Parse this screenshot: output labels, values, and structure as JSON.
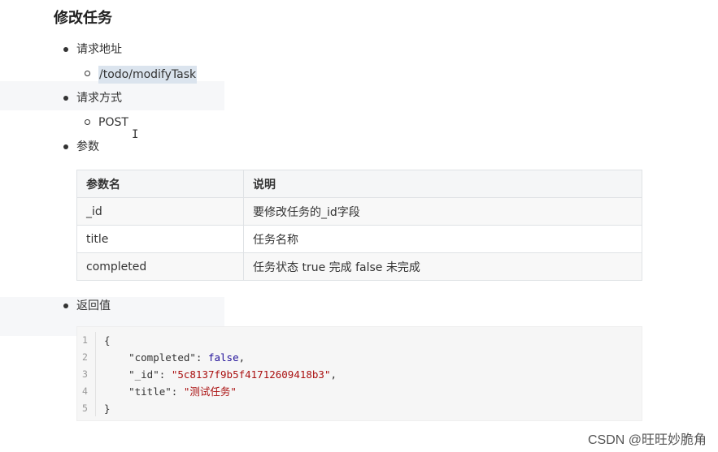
{
  "heading": "修改任务",
  "sections": {
    "request_url_label": "请求地址",
    "request_url_value": "/todo/modifyTask",
    "request_method_label": "请求方式",
    "request_method_value": "POST",
    "params_label": "参数",
    "return_label": "返回值"
  },
  "params_table": {
    "headers": [
      "参数名",
      "说明"
    ],
    "rows": [
      [
        "_id",
        "要修改任务的_id字段"
      ],
      [
        "title",
        "任务名称"
      ],
      [
        "completed",
        "任务状态 true 完成 false 未完成"
      ]
    ]
  },
  "code_block": {
    "line_numbers": [
      "1",
      "2",
      "3",
      "4",
      "5"
    ],
    "lines": {
      "l1": "{",
      "l2_key": "\"completed\"",
      "l2_sep": ": ",
      "l2_val": "false",
      "l2_end": ",",
      "l3_key": "\"_id\"",
      "l3_sep": ": ",
      "l3_val": "\"5c8137f9b5f41712609418b3\"",
      "l3_end": ",",
      "l4_key": "\"title\"",
      "l4_sep": ": ",
      "l4_val": "\"测试任务\"",
      "l5": "}"
    }
  },
  "watermark": "CSDN @旺旺妙脆角",
  "cursor_glyph": "I",
  "colors": {
    "highlight": "#dbe4ee",
    "string_token": "#aa1111",
    "boolean_token": "#221199"
  }
}
